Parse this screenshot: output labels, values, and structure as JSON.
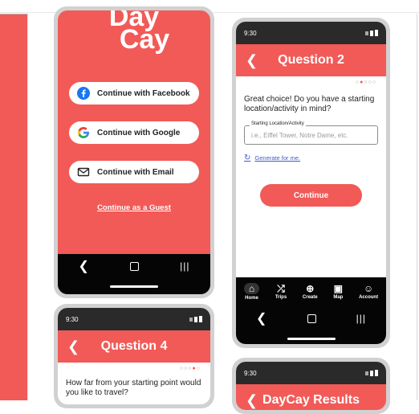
{
  "colors": {
    "brand": "#f25a57",
    "nav": "#050505",
    "link": "#3a5bd0"
  },
  "login": {
    "logo_line1": "Day",
    "logo_line2": "Cay",
    "facebook_label": "Continue with Facebook",
    "google_label": "Continue with Google",
    "email_label": "Continue with Email",
    "guest_label": "Continue as a Guest"
  },
  "question2": {
    "status_time": "9:30",
    "title": "Question 2",
    "dots_before": "○",
    "dot_active": "●",
    "dots_after": "○○○",
    "prompt": "Great choice! Do you have a starting location/activity in mind?",
    "field_label": "Starting Location/Activity",
    "field_placeholder": "i.e., Eiffel Tower, Notre Dame, etc.",
    "generate_label": "Generate for me.",
    "continue_label": "Continue",
    "tabs": [
      {
        "label": "Home",
        "icon": "home-icon"
      },
      {
        "label": "Trips",
        "icon": "shuffle-icon"
      },
      {
        "label": "Create",
        "icon": "add-circle-icon"
      },
      {
        "label": "Map",
        "icon": "map-pin-icon"
      },
      {
        "label": "Account",
        "icon": "person-icon"
      }
    ]
  },
  "question4": {
    "status_time": "9:30",
    "title": "Question 4",
    "dots_before": "○○○",
    "dot_active": "●",
    "dots_after": "○",
    "prompt": "How far from your starting point would you like to travel?"
  },
  "results": {
    "status_time": "9:30",
    "title": "DayCay Results"
  }
}
